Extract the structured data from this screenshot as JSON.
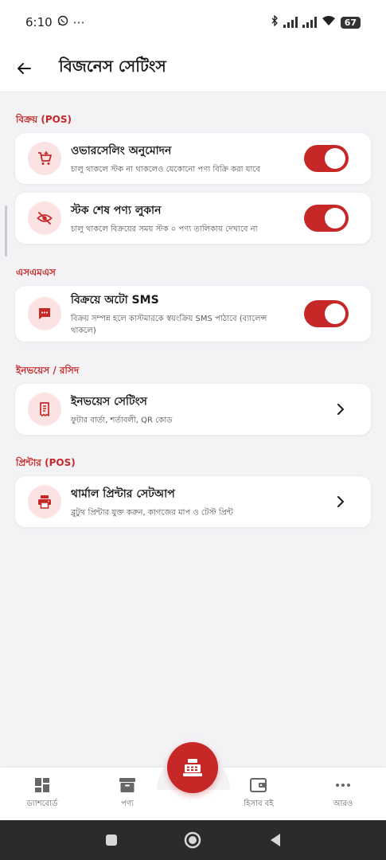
{
  "status_bar": {
    "time": "6:10",
    "extra": "⋯",
    "battery": "67"
  },
  "app_bar": {
    "title": "বিজনেস সেটিংস"
  },
  "sections": [
    {
      "label": "বিক্রয় (POS)",
      "items": [
        {
          "title": "ওভারসেলিং অনুমোদন",
          "subtitle": "চালু থাকলে স্টক না থাকলেও যেকোনো পণ্য বিক্রি করা যাবে",
          "enabled": true
        },
        {
          "title": "স্টক শেষ পণ্য লুকান",
          "subtitle": "চালু থাকলে বিক্রয়ের সময় স্টক ০ পণ্য তালিকায় দেখাবে না",
          "enabled": true
        }
      ]
    },
    {
      "label": "এসএমএস",
      "items": [
        {
          "title": "বিক্রয়ে অটো SMS",
          "subtitle": "বিক্রয় সম্পন্ন হলে কাস্টমারকে স্বয়ংক্রিয় SMS পাঠাবে (ব্যালেন্স থাকলে)",
          "enabled": true
        }
      ]
    },
    {
      "label": "ইনভয়েস / রসিদ",
      "items": [
        {
          "title": "ইনভয়েস সেটিংস",
          "subtitle": "ফুটার বার্তা, শর্তাবলী, QR কোড"
        }
      ]
    },
    {
      "label": "প্রিন্টার (POS)",
      "items": [
        {
          "title": "থার্মাল প্রিন্টার সেটআপ",
          "subtitle": "ব্লুটুথ প্রিন্টার যুক্ত করুন, কাগজের মাপ ও টেস্ট প্রিন্ট"
        }
      ]
    }
  ],
  "bottom_nav": [
    {
      "label": "ড্যাশবোর্ড",
      "icon": "dashboard-icon"
    },
    {
      "label": "পণ্য",
      "icon": "archive-icon"
    },
    {
      "label": "হিসাব বই",
      "icon": "wallet-icon"
    },
    {
      "label": "আরও",
      "icon": "more-icon"
    }
  ],
  "fab": {
    "icon": "cash-register-icon"
  },
  "colors": {
    "accent": "#c62828",
    "icon_bg": "#fbe3e3",
    "page_bg": "#f3f3f6"
  }
}
